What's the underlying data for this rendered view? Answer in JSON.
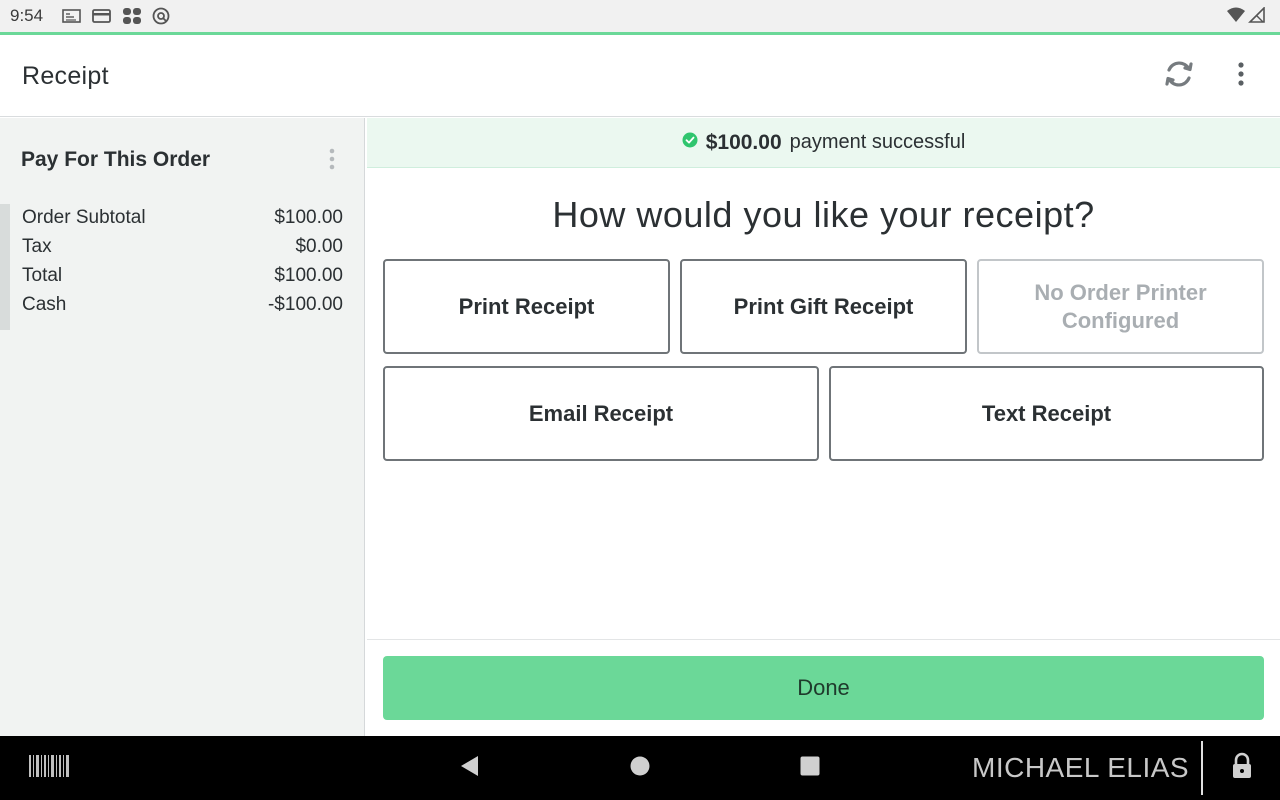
{
  "status_bar": {
    "time": "9:54",
    "left_icons": [
      "notification-icon",
      "card-icon",
      "clover-icon",
      "sync-status-icon"
    ],
    "right_icons": [
      "wifi-icon",
      "signal-icon"
    ]
  },
  "app_bar": {
    "title": "Receipt",
    "actions": [
      "refresh-icon",
      "more-vert-icon"
    ]
  },
  "order_summary": {
    "title": "Pay For This Order",
    "rows": [
      {
        "label": "Order Subtotal",
        "value": "$100.00"
      },
      {
        "label": "Tax",
        "value": "$0.00"
      },
      {
        "label": "Total",
        "value": "$100.00"
      },
      {
        "label": "Cash",
        "value": "-$100.00"
      }
    ]
  },
  "banner": {
    "amount": "$100.00",
    "message": "payment successful"
  },
  "receipt": {
    "question": "How would you like your receipt?",
    "options": {
      "print": "Print Receipt",
      "gift": "Print Gift Receipt",
      "no_printer": "No Order Printer Configured",
      "email": "Email Receipt",
      "text": "Text Receipt"
    },
    "done": "Done"
  },
  "nav_bar": {
    "user": "MICHAEL ELIAS"
  },
  "colors": {
    "accent": "#6bd898",
    "banner_bg": "#ebf8f0",
    "success_icon": "#2fc56e",
    "text": "#2b3033"
  }
}
